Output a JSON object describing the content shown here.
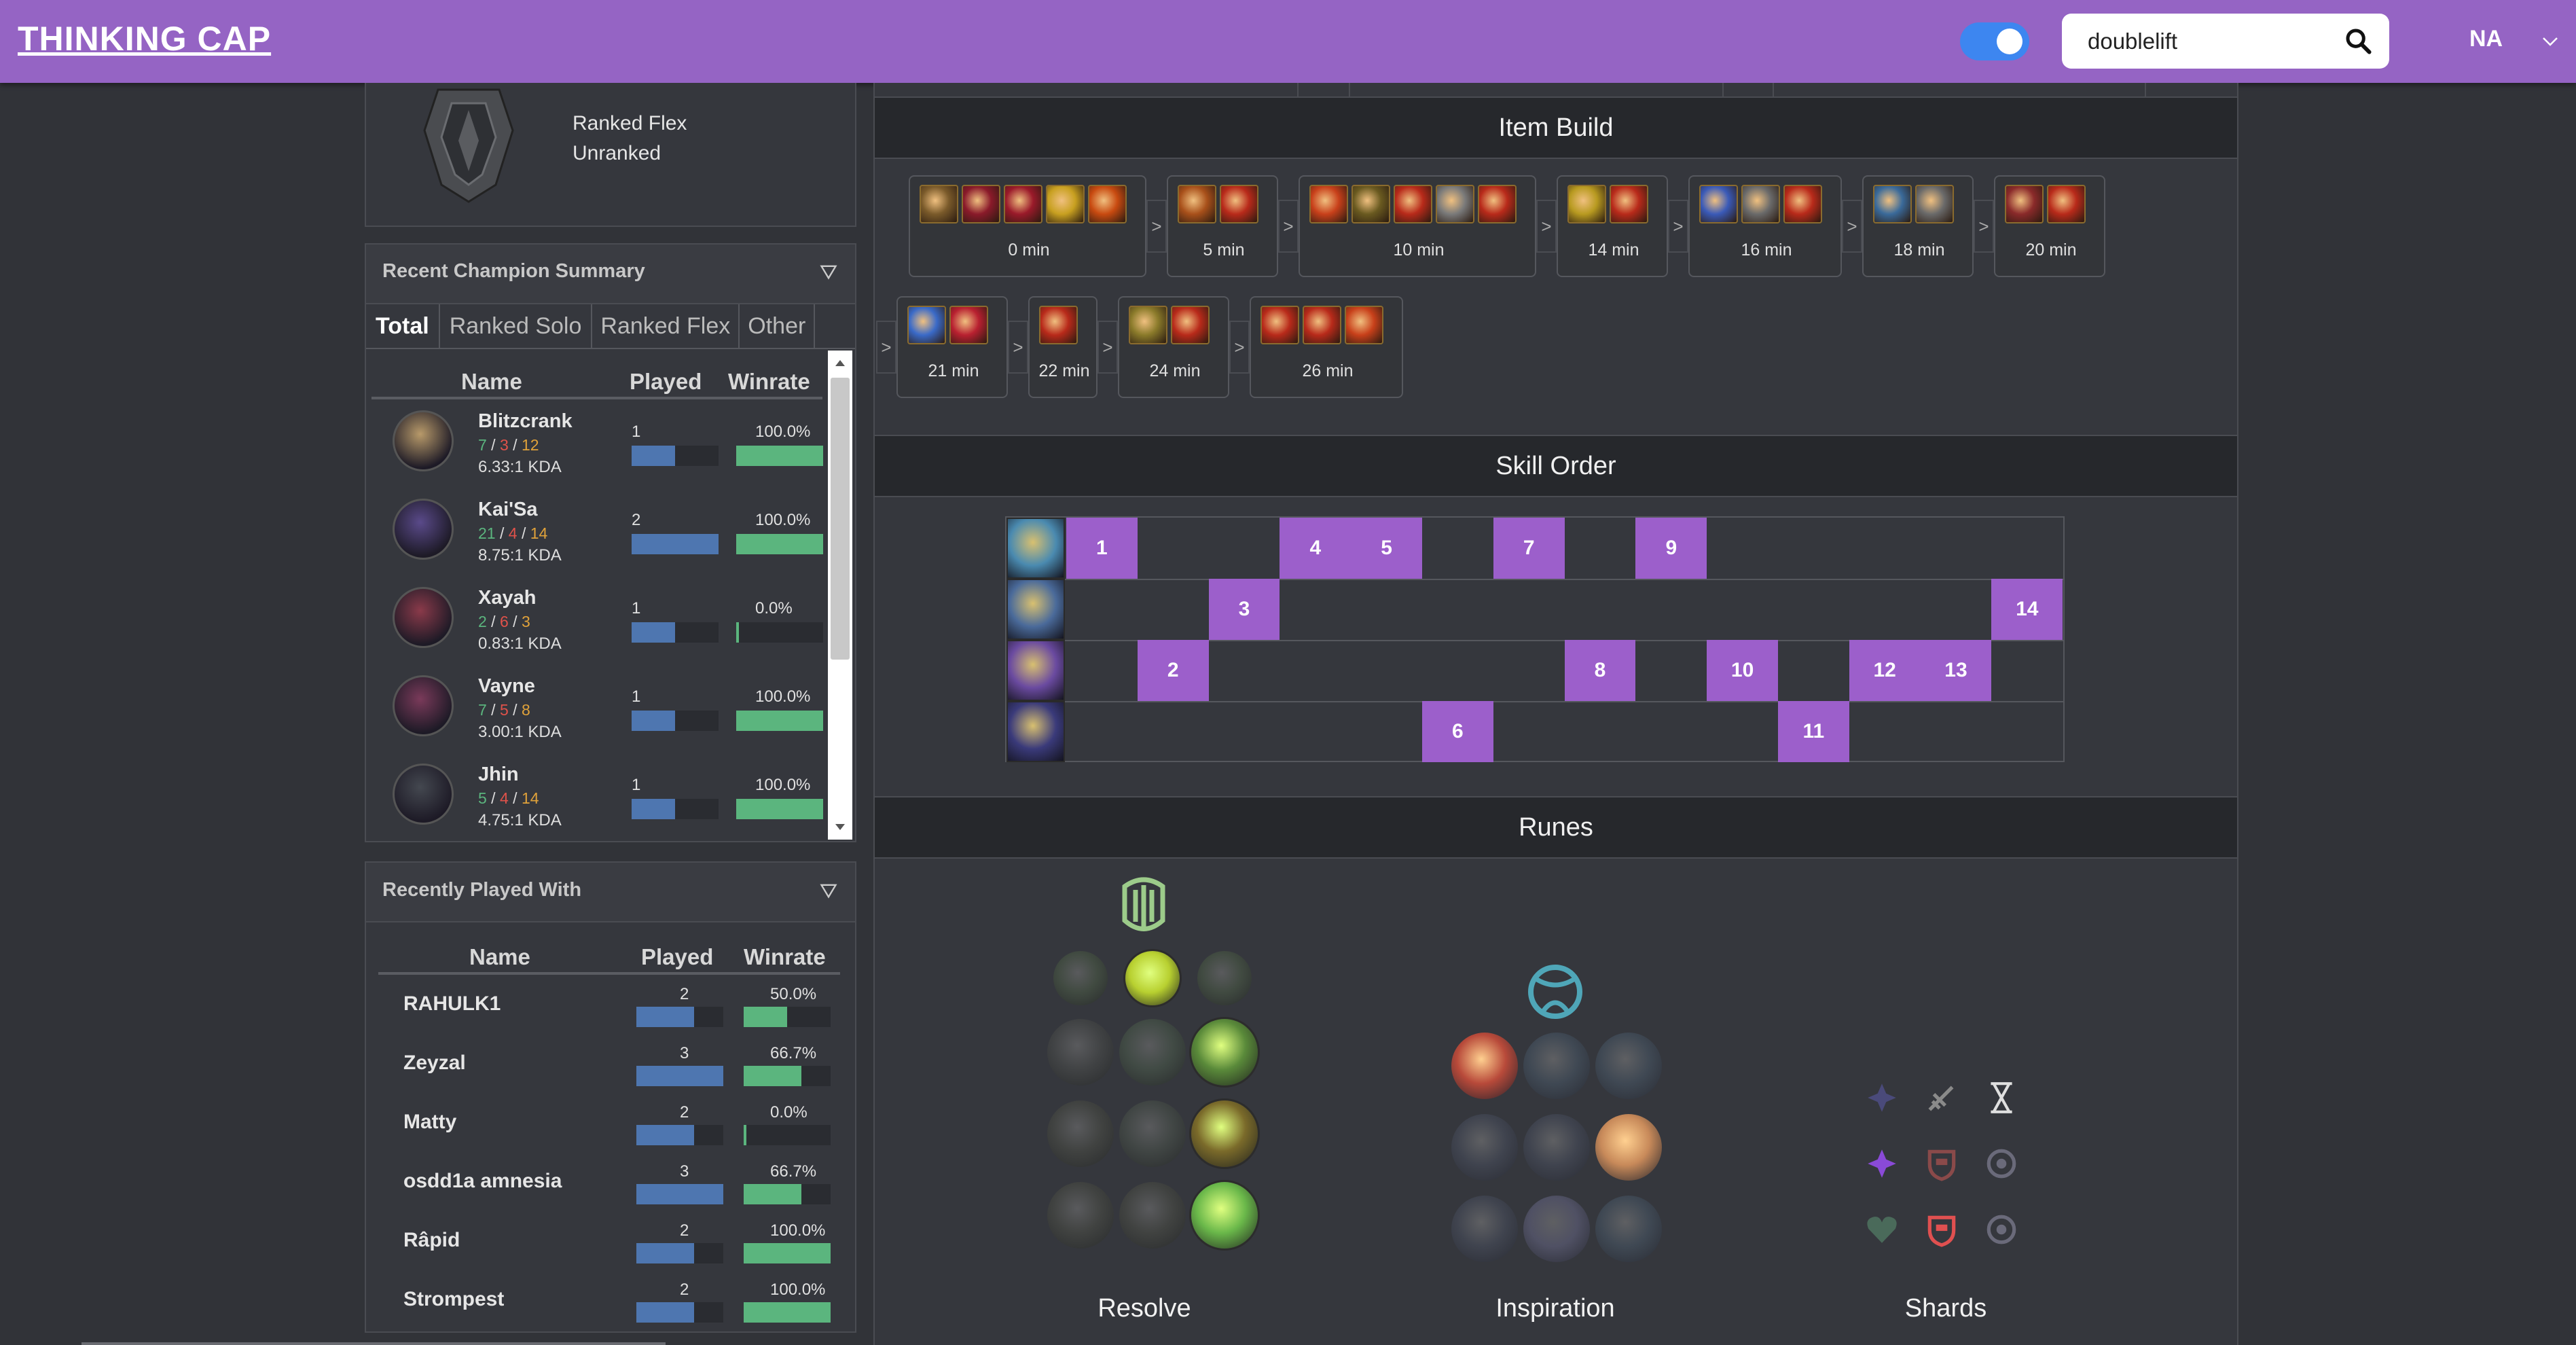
{
  "header": {
    "logo": "THINKING CAP",
    "search_value": "doublelift",
    "region": "NA",
    "toggle_on": true
  },
  "rank_card": {
    "queue": "Ranked Flex",
    "tier": "Unranked"
  },
  "recent_champions": {
    "title": "Recent Champion Summary",
    "tabs": [
      "Total",
      "Ranked Solo",
      "Ranked Flex",
      "Other"
    ],
    "active_tab": "Total",
    "columns": [
      "Name",
      "Played",
      "Winrate"
    ],
    "rows": [
      {
        "name": "Blitzcrank",
        "k": "7",
        "d": "3",
        "a": "12",
        "kda": "6.33:1 KDA",
        "played": "1",
        "played_frac": 0.5,
        "winrate": "100.0%",
        "winrate_frac": 1.0,
        "avatar_color": "#b89a6a"
      },
      {
        "name": "Kai'Sa",
        "k": "21",
        "d": "4",
        "a": "14",
        "kda": "8.75:1 KDA",
        "played": "2",
        "played_frac": 1.0,
        "winrate": "100.0%",
        "winrate_frac": 1.0,
        "avatar_color": "#5a4a8a"
      },
      {
        "name": "Xayah",
        "k": "2",
        "d": "6",
        "a": "3",
        "kda": "0.83:1 KDA",
        "played": "1",
        "played_frac": 0.5,
        "winrate": "0.0%",
        "winrate_frac": 0.0,
        "avatar_color": "#8a3a4a"
      },
      {
        "name": "Vayne",
        "k": "7",
        "d": "5",
        "a": "8",
        "kda": "3.00:1 KDA",
        "played": "1",
        "played_frac": 0.5,
        "winrate": "100.0%",
        "winrate_frac": 1.0,
        "avatar_color": "#7a3a5a"
      },
      {
        "name": "Jhin",
        "k": "5",
        "d": "4",
        "a": "14",
        "kda": "4.75:1 KDA",
        "played": "1",
        "played_frac": 0.5,
        "winrate": "100.0%",
        "winrate_frac": 1.0,
        "avatar_color": "#444850"
      }
    ]
  },
  "recently_played_with": {
    "title": "Recently Played With",
    "columns": [
      "Name",
      "Played",
      "Winrate"
    ],
    "rows": [
      {
        "name": "RAHULK1",
        "played": "2",
        "played_frac": 0.667,
        "winrate": "50.0%",
        "winrate_frac": 0.5
      },
      {
        "name": "Zeyzal",
        "played": "3",
        "played_frac": 1.0,
        "winrate": "66.7%",
        "winrate_frac": 0.667
      },
      {
        "name": "Matty",
        "played": "2",
        "played_frac": 0.667,
        "winrate": "0.0%",
        "winrate_frac": 0.0
      },
      {
        "name": "osdd1a amnesia",
        "played": "3",
        "played_frac": 1.0,
        "winrate": "66.7%",
        "winrate_frac": 0.667
      },
      {
        "name": "Râpid",
        "played": "2",
        "played_frac": 0.667,
        "winrate": "100.0%",
        "winrate_frac": 1.0
      },
      {
        "name": "Strompest",
        "played": "2",
        "played_frac": 0.667,
        "winrate": "100.0%",
        "winrate_frac": 1.0
      }
    ]
  },
  "item_build": {
    "title": "Item Build",
    "separator": ">",
    "groups": [
      {
        "time": "0 min",
        "items": [
          "#7a5a2a",
          "#8a1a2a",
          "#9a1a2a",
          "#c8a020",
          "#c84a10"
        ]
      },
      {
        "time": "5 min",
        "items": [
          "#a8501a",
          "#b82a1a"
        ]
      },
      {
        "time": "10 min",
        "items": [
          "#c8401a",
          "#6a5a20",
          "#b82a1a",
          "#7a7a7a",
          "#b82a1a"
        ]
      },
      {
        "time": "14 min",
        "items": [
          "#b89a20",
          "#b82a1a"
        ]
      },
      {
        "time": "16 min",
        "items": [
          "#3a5ab8",
          "#6a6a6a",
          "#b82a1a"
        ]
      },
      {
        "time": "18 min",
        "items": [
          "#3a6a9a",
          "#6a6a6a"
        ]
      },
      {
        "time": "20 min",
        "items": [
          "#8a2a2a",
          "#b82a1a"
        ]
      },
      {
        "time": "21 min",
        "items": [
          "#3a6ac8",
          "#b82030"
        ]
      },
      {
        "time": "22 min",
        "items": [
          "#b82a1a"
        ]
      },
      {
        "time": "24 min",
        "items": [
          "#8a7a2a",
          "#b82a1a"
        ]
      },
      {
        "time": "26 min",
        "items": [
          "#b82a1a",
          "#b82a1a",
          "#c8401a"
        ]
      }
    ]
  },
  "skill_order": {
    "title": "Skill Order",
    "rows": [
      {
        "skill": "Q",
        "icon_color": "#4a8ab0",
        "levels": [
          1,
          4,
          5,
          7,
          9
        ]
      },
      {
        "skill": "W",
        "icon_color": "#4a6a9a",
        "levels": [
          3,
          14
        ]
      },
      {
        "skill": "E",
        "icon_color": "#6a4aa0",
        "levels": [
          2,
          8,
          10,
          12,
          13
        ]
      },
      {
        "skill": "R",
        "icon_color": "#3a3a7a",
        "levels": [
          6,
          11
        ]
      }
    ]
  },
  "runes": {
    "title": "Runes",
    "primary_label": "Resolve",
    "secondary_label": "Inspiration",
    "shards_label": "Shards"
  }
}
